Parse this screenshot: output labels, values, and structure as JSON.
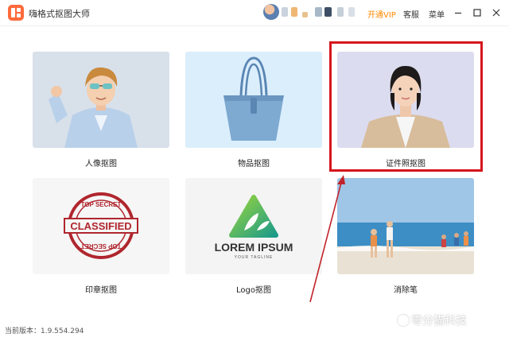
{
  "window": {
    "title": "嗨格式抠图大师",
    "vip_label": "开通VIP",
    "support_label": "客服",
    "menu_label": "菜单",
    "accent": "#ff8a00",
    "logo_color": "#ff6a3d"
  },
  "features": [
    {
      "label": "人像抠图",
      "icon": "portrait-child-photo"
    },
    {
      "label": "物品抠图",
      "icon": "handbag-photo"
    },
    {
      "label": "证件照抠图",
      "icon": "id-photo-woman"
    },
    {
      "label": "印章抠图",
      "icon": "classified-stamp"
    },
    {
      "label": "Logo抠图",
      "icon": "lorem-ipsum-logo"
    },
    {
      "label": "消除笔",
      "icon": "beach-photo"
    }
  ],
  "stamp": {
    "top_text": "TOP SECRET",
    "main_text": "CLASSIFIED",
    "bottom_text": "TOP SECRET"
  },
  "logo_sample": {
    "title": "LOREM IPSUM",
    "tagline": "YOUR TAGLINE"
  },
  "annotation": {
    "highlight_color": "#d5151d"
  },
  "footer": {
    "version": "当前版本：1.9.554.294"
  },
  "watermark": {
    "text": "零分猫科技"
  }
}
